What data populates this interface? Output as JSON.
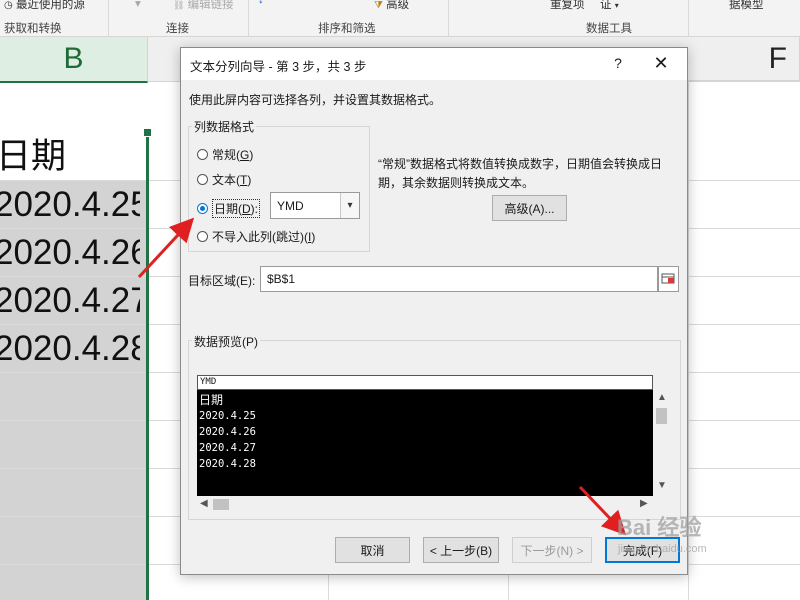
{
  "ribbon": {
    "recent_sources": "最近使用的源",
    "edit_links": "编辑链接",
    "advanced": "高级",
    "duplicates": "重复项",
    "validation": "证",
    "data_model": "据模型",
    "groups": {
      "get_transform": "获取和转换",
      "connections": "连接",
      "sort_filter": "排序和筛选",
      "data_tools": "数据工具"
    }
  },
  "sheet": {
    "columns": {
      "b": "B",
      "f": "F"
    },
    "cells": [
      "日期",
      "2020.4.25",
      "2020.4.26",
      "2020.4.27",
      "2020.4.28"
    ]
  },
  "dialog": {
    "title": "文本分列向导 - 第 3 步，共 3 步",
    "help": "?",
    "close": "✕",
    "instruction": "使用此屏内容可选择各列，并设置其数据格式。",
    "format_group": {
      "legend": "列数据格式",
      "options": [
        {
          "label": "常规(",
          "key": "G",
          "after": ")",
          "selected": false
        },
        {
          "label": "文本(",
          "key": "T",
          "after": ")",
          "selected": false
        },
        {
          "label": "日期(",
          "key": "D",
          "after": "):",
          "selected": true
        },
        {
          "label": "不导入此列(跳过)(",
          "key": "I",
          "after": ")",
          "selected": false
        }
      ],
      "date_format": "YMD"
    },
    "description": "“常规”数据格式将数值转换成数字，日期值会转换成日期，其余数据则转换成文本。",
    "advanced_button": "高级(A)...",
    "destination": {
      "label": "目标区域(E):",
      "value": "$B$1"
    },
    "preview": {
      "legend": "数据预览(P)",
      "header": "YMD",
      "rows": [
        "日期",
        "2020.4.25",
        "2020.4.26",
        "2020.4.27",
        "2020.4.28"
      ]
    },
    "buttons": {
      "cancel": "取消",
      "back": "< 上一步(B)",
      "next": "下一步(N) >",
      "finish": "完成(F)"
    }
  },
  "watermark": {
    "brand": "Bai 经验",
    "url": "jingyan.baidu.com"
  },
  "colors": {
    "excel_green": "#217346",
    "arrow_red": "#e02020",
    "accent_blue": "#0078d7"
  }
}
